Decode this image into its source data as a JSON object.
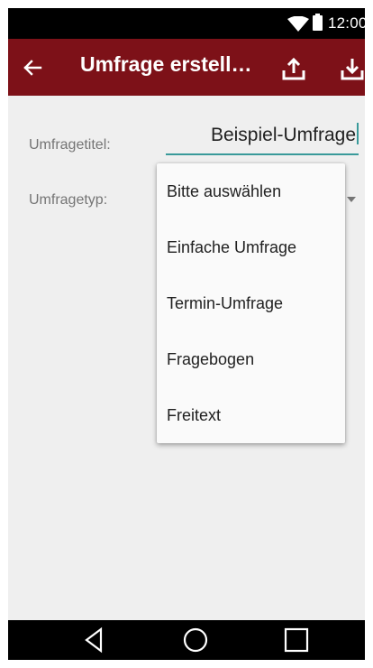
{
  "status_bar": {
    "time": "12:00",
    "wifi_icon": "wifi-icon",
    "battery_icon": "battery-icon"
  },
  "app_bar": {
    "title": "Umfrage erstell…",
    "back_icon": "back-arrow-icon",
    "upload_icon": "upload-icon",
    "download_icon": "download-icon",
    "background_color": "#7d1118"
  },
  "form": {
    "title_label": "Umfragetitel:",
    "title_value": "Beispiel-Umfrage",
    "type_label": "Umfragetyp:",
    "accent_color": "#3a9a9a"
  },
  "dropdown": {
    "options": [
      "Bitte auswählen",
      "Einfache Umfrage",
      "Termin-Umfrage",
      "Fragebogen",
      "Freitext"
    ]
  },
  "nav_bar": {
    "back_icon": "nav-back-icon",
    "home_icon": "nav-home-icon",
    "recents_icon": "nav-recents-icon"
  }
}
